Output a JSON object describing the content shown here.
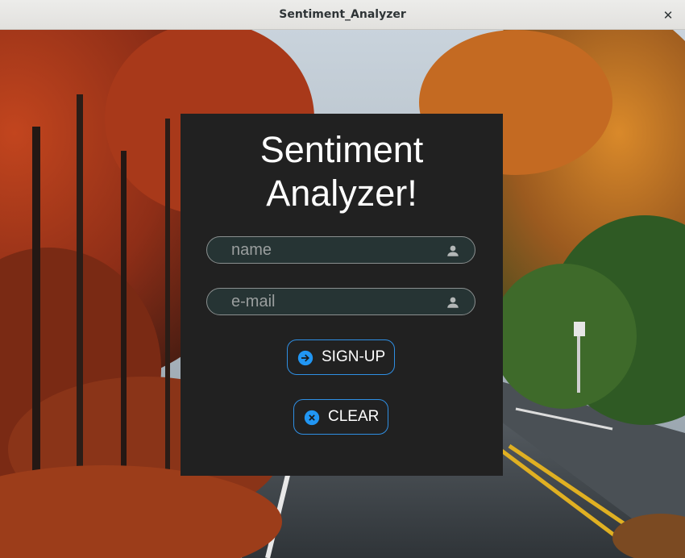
{
  "window": {
    "title": "Sentiment_Analyzer",
    "close_glyph": "✕"
  },
  "card": {
    "heading_line1": "Sentiment",
    "heading_line2": "Analyzer!"
  },
  "form": {
    "name_placeholder": "name",
    "name_value": "",
    "email_placeholder": "e-mail",
    "email_value": ""
  },
  "buttons": {
    "signup_label": "SIGN-UP",
    "clear_label": "CLEAR"
  },
  "icons": {
    "field_icon": "account-icon",
    "signup_icon": "arrow-right-circle-icon",
    "clear_icon": "close-circle-icon"
  },
  "colors": {
    "card_background": "#212121",
    "field_background": "#263434",
    "accent": "#2f8fe3",
    "icon_blue": "#2196f3"
  }
}
